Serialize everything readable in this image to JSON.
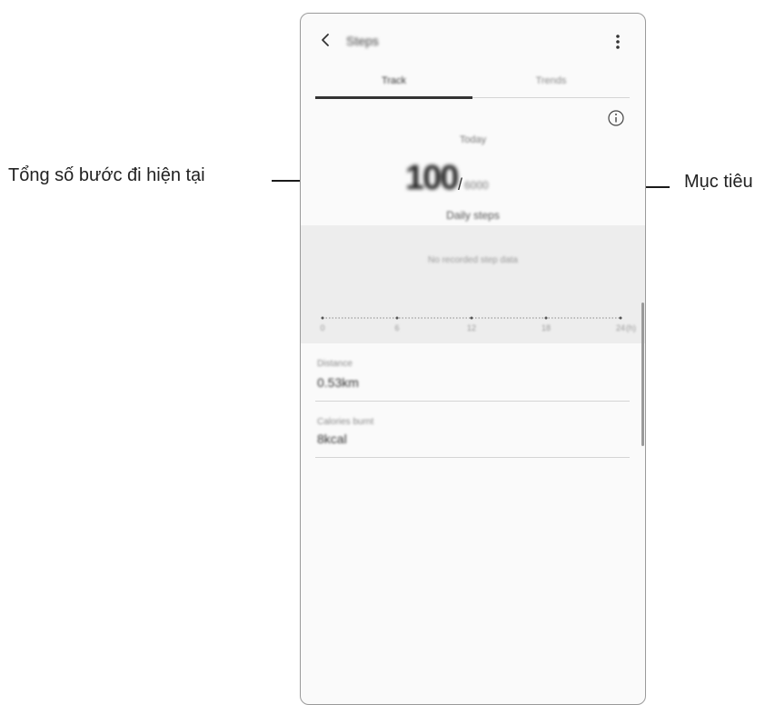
{
  "callouts": {
    "current_steps_label": "Tổng số bước đi hiện tại",
    "target_label": "Mục tiêu"
  },
  "app": {
    "title": "Steps",
    "icons": {
      "back": "chevron-left-icon",
      "more": "more-vertical-icon",
      "info": "info-icon"
    }
  },
  "tabs": [
    {
      "label": "Track",
      "active": true
    },
    {
      "label": "Trends",
      "active": false
    }
  ],
  "summary": {
    "period": "Today",
    "steps": "100",
    "separator": "/",
    "goal": "6000",
    "caption": "Daily steps"
  },
  "chart": {
    "no_data_text": "No recorded step data",
    "tick_labels": [
      "0",
      "6",
      "12",
      "18",
      "24"
    ],
    "unit": "(h)"
  },
  "stats": [
    {
      "label": "Distance",
      "value": "0.53km"
    },
    {
      "label": "Calories burnt",
      "value": "8kcal"
    }
  ],
  "colors": {
    "text": "#1a1a1a",
    "chart_bg": "#ededed",
    "divider": "#d4d4d4"
  }
}
